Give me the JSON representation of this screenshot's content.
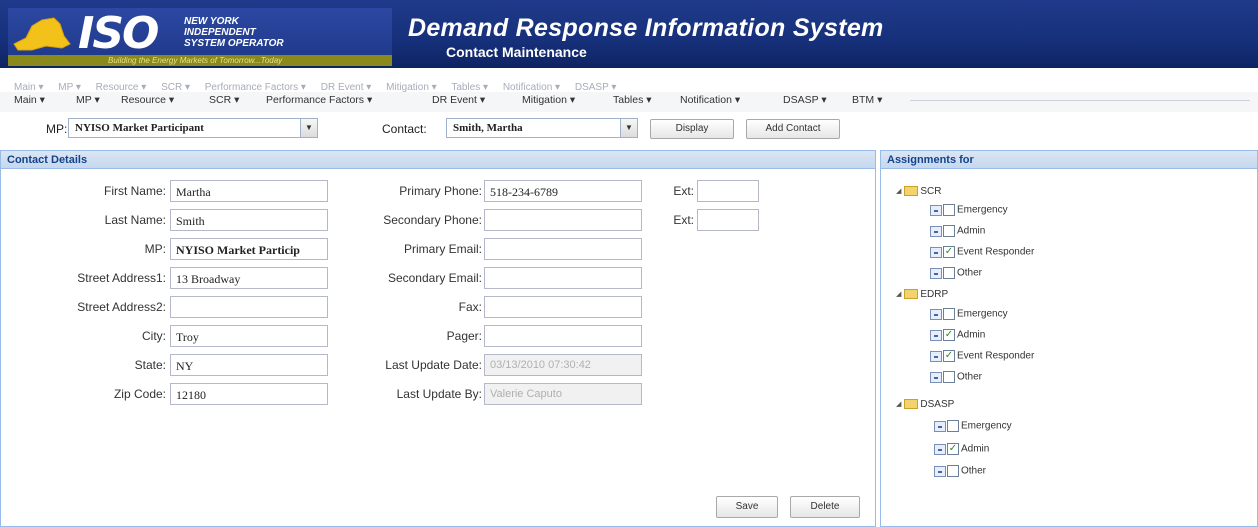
{
  "header": {
    "logo_iso": "ISO",
    "logo_lines": [
      "NEW YORK",
      "INDEPENDENT",
      "SYSTEM OPERATOR"
    ],
    "logo_tagline": "Building the Energy Markets of Tomorrow...Today",
    "title": "Demand Response Information System",
    "subtitle": "Contact Maintenance"
  },
  "menu": {
    "items": [
      "Main ▾",
      "MP ▾",
      "Resource ▾",
      "SCR ▾",
      "Performance Factors ▾",
      "DR Event ▾",
      "Mitigation ▾",
      "Tables ▾",
      "Notification ▾",
      "DSASP ▾",
      "BTM ▾"
    ],
    "ghost_items": [
      "Main ▾",
      "MP ▾",
      "Resource ▾",
      "SCR ▾",
      "Performance Factors ▾",
      "DR Event ▾",
      "Mitigation ▾",
      "Tables ▾",
      "Notification ▾",
      "DSASP ▾"
    ]
  },
  "toolbar": {
    "mp_label": "MP:",
    "mp_value": "NYISO Market Participant",
    "contact_label": "Contact:",
    "contact_value": "Smith, Martha",
    "display_label": "Display",
    "add_contact_label": "Add Contact"
  },
  "details": {
    "header": "Contact Details",
    "first_name_label": "First Name:",
    "first_name": "Martha",
    "last_name_label": "Last Name:",
    "last_name": "Smith",
    "mp_label": "MP:",
    "mp": "NYISO Market Particip",
    "street1_label": "Street Address1:",
    "street1": "13 Broadway",
    "street2_label": "Street Address2:",
    "street2": "",
    "city_label": "City:",
    "city": "Troy",
    "state_label": "State:",
    "state": "NY",
    "zip_label": "Zip Code:",
    "zip": "12180",
    "primary_phone_label": "Primary Phone:",
    "primary_phone": "518-234-6789",
    "ext1_label": "Ext:",
    "ext1": "",
    "secondary_phone_label": "Secondary Phone:",
    "secondary_phone": "",
    "ext2_label": "Ext:",
    "ext2": "",
    "primary_email_label": "Primary Email:",
    "primary_email": "",
    "secondary_email_label": "Secondary Email:",
    "secondary_email": "",
    "fax_label": "Fax:",
    "fax": "",
    "pager_label": "Pager:",
    "pager": "",
    "last_update_date_label": "Last Update Date:",
    "last_update_date": "03/13/2010 07:30:42",
    "last_update_by_label": "Last Update By:",
    "last_update_by": "Valerie Caputo",
    "save_label": "Save",
    "delete_label": "Delete"
  },
  "assignments": {
    "header": "Assignments for",
    "groups": [
      {
        "name": "SCR",
        "items": [
          {
            "label": "Emergency",
            "checked": false
          },
          {
            "label": "Admin",
            "checked": false
          },
          {
            "label": "Event Responder",
            "checked": true
          },
          {
            "label": "Other",
            "checked": false
          }
        ]
      },
      {
        "name": "EDRP",
        "items": [
          {
            "label": "Emergency",
            "checked": false
          },
          {
            "label": "Admin",
            "checked": true
          },
          {
            "label": "Event Responder",
            "checked": true
          },
          {
            "label": "Other",
            "checked": false
          }
        ]
      },
      {
        "name": "DSASP",
        "items": [
          {
            "label": "Emergency",
            "checked": false
          },
          {
            "label": "Admin",
            "checked": true
          },
          {
            "label": "Other",
            "checked": false
          }
        ]
      }
    ]
  },
  "colors": {
    "header_bg": "#1f3a8a",
    "panel_header_text": "#15428b",
    "panel_border": "#99bbe8"
  }
}
